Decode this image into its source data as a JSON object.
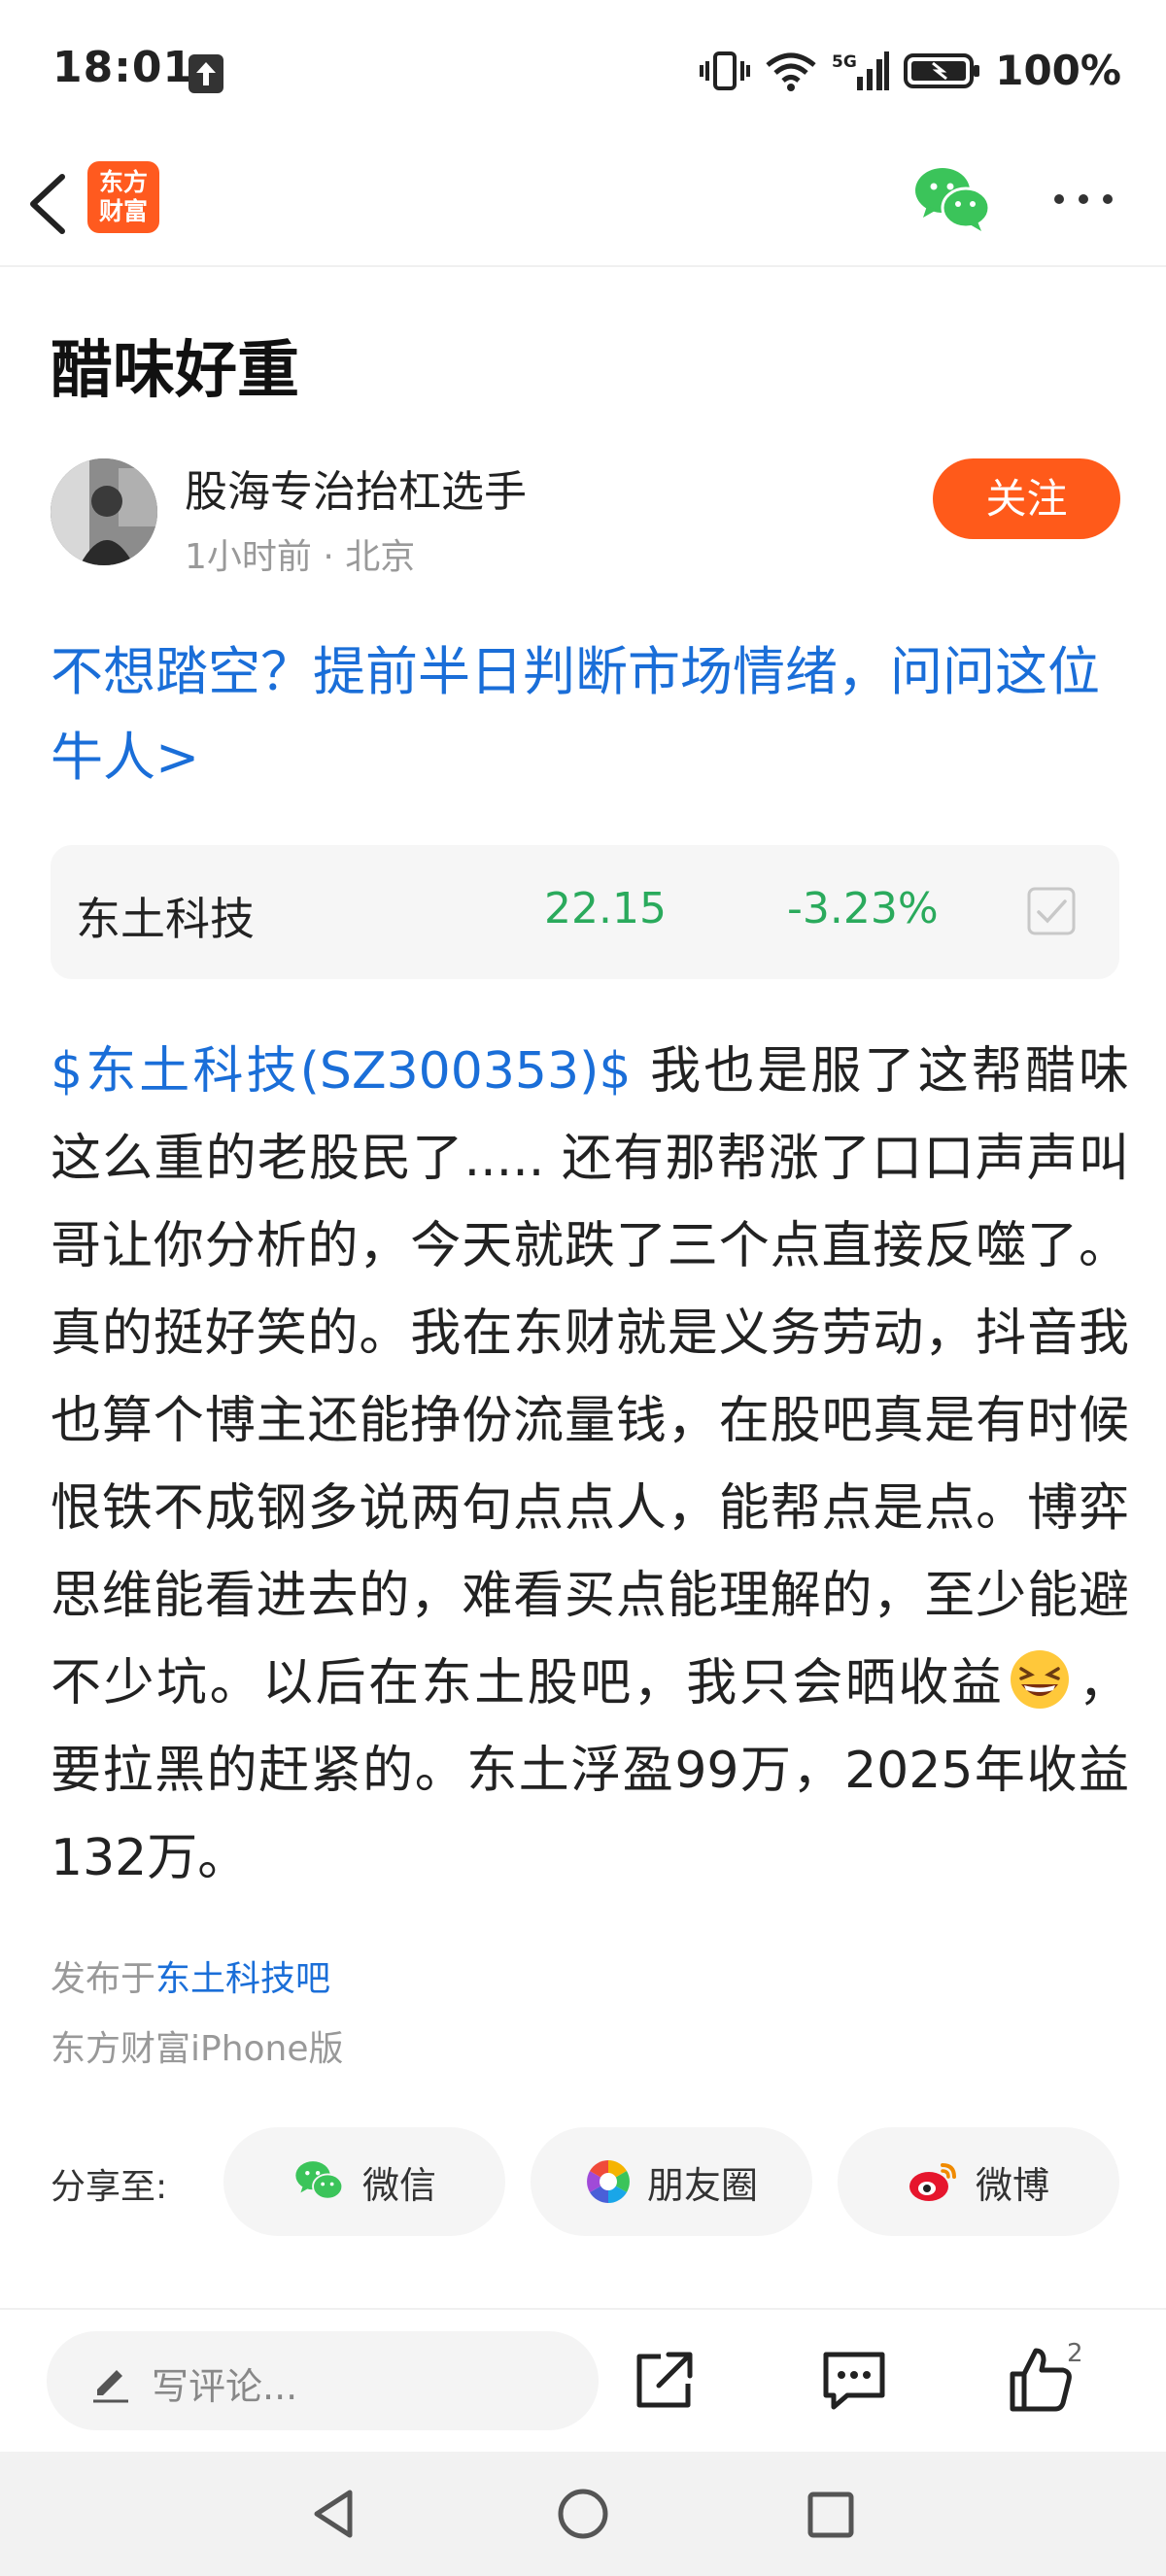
{
  "status_bar": {
    "time": "18:01",
    "battery": "100%",
    "network": "5G"
  },
  "header": {
    "logo_text_line1": "东方",
    "logo_text_line2": "财富",
    "icons": [
      "back-arrow-icon",
      "wechat-icon",
      "more-icon"
    ]
  },
  "post": {
    "title": "醋味好重",
    "author": "股海专治抬杠选手",
    "meta": "1小时前 · 北京",
    "follow_label": "关注",
    "promo": "不想踏空？提前半日判断市场情绪，问问这位牛人>",
    "stock": {
      "name": "东土科技",
      "price": "22.15",
      "change": "-3.23%"
    },
    "body_link": "$东土科技(SZ300353)$",
    "body_part1": " 我也是服了这帮醋味这么重的老股民了..... 还有那帮涨了口口声声叫哥让你分析的，今天就跌了三个点直接反噬了。真的挺好笑的。我在东财就是义务劳动，抖音我也算个博主还能挣份流量钱，在股吧真是有时候恨铁不成钢多说两句点点人，能帮点是点。博弈思维能看进去的，难看买点能理解的，至少能避不少坑。以后在东土股吧，我只会晒收益",
    "body_part2": "，要拉黑的赶紧的。东土浮盈99万，2025年收益132万。",
    "published_prefix": "发布于",
    "published_bar": "东土科技吧",
    "device": "东方财富iPhone版"
  },
  "share": {
    "label": "分享至:",
    "wechat": "微信",
    "moments": "朋友圈",
    "weibo": "微博"
  },
  "bottom_bar": {
    "comment_placeholder": "写评论...",
    "like_count": "2"
  },
  "colors": {
    "accent_orange": "#ff5a1a",
    "link_blue": "#1a6ed8",
    "stock_green": "#2aaa5c",
    "wechat_green": "#3bc45a",
    "weibo_red": "#e6162d"
  }
}
